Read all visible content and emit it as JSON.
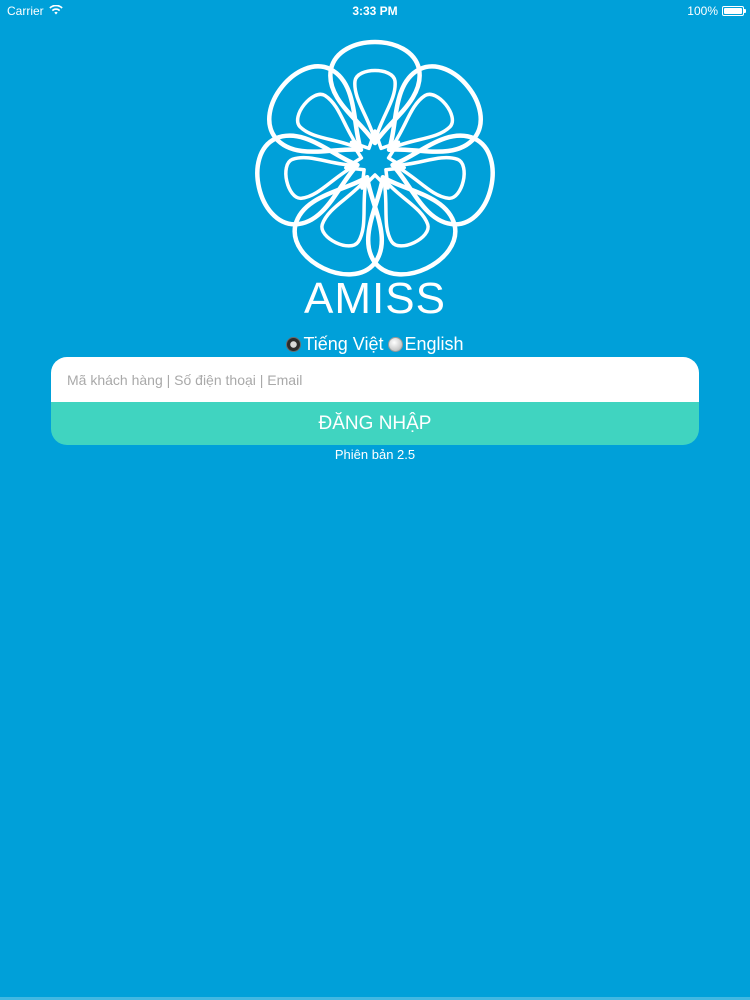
{
  "status_bar": {
    "carrier": "Carrier",
    "time": "3:33 PM",
    "battery_text": "100%",
    "battery_level": 1.0
  },
  "brand": {
    "name": "AMISS",
    "logo_icon": "flower-logo-icon"
  },
  "language": {
    "options": [
      {
        "label": "Tiếng Việt",
        "selected": true
      },
      {
        "label": "English",
        "selected": false
      }
    ]
  },
  "login": {
    "input_placeholder": "Mã khách hàng | Số điện thoại | Email",
    "input_value": "",
    "button_label": "ĐĂNG NHẬP"
  },
  "version_text": "Phiên bản 2.5",
  "colors": {
    "background": "#00a0d9",
    "button": "#40d4c0",
    "text": "#ffffff"
  }
}
